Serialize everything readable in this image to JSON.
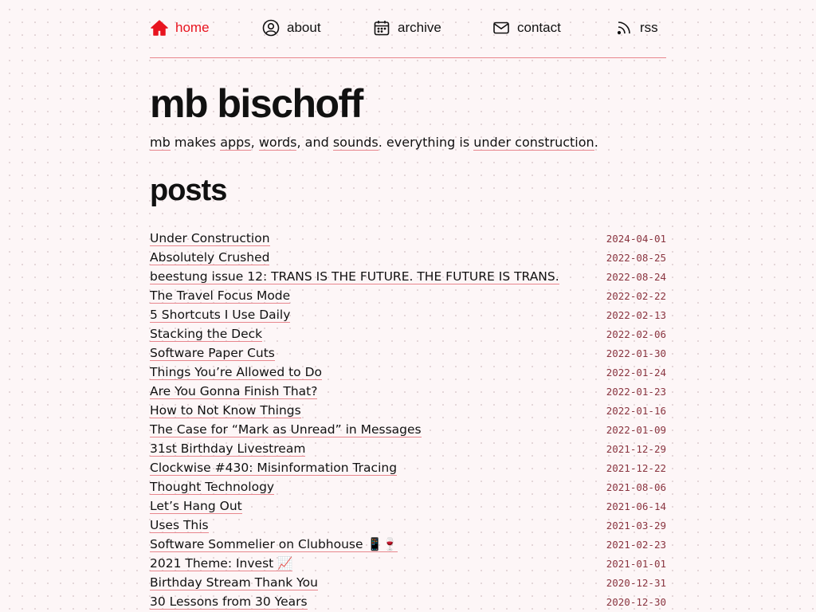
{
  "nav": {
    "items": [
      {
        "label": "home",
        "icon": "home-icon",
        "active": true
      },
      {
        "label": "about",
        "icon": "user-circle-icon",
        "active": false
      },
      {
        "label": "archive",
        "icon": "calendar-icon",
        "active": false
      },
      {
        "label": "contact",
        "icon": "mail-icon",
        "active": false
      },
      {
        "label": "rss",
        "icon": "rss-icon",
        "active": false
      }
    ]
  },
  "site": {
    "title": "mb bischoff",
    "tagline": {
      "mb": "mb",
      "makes": " makes ",
      "apps": "apps",
      "comma1": ", ",
      "words": "words",
      "and": ", and ",
      "sounds": "sounds",
      "everything": ". everything is ",
      "construction": "under construction",
      "period": "."
    }
  },
  "posts": {
    "heading": "posts",
    "items": [
      {
        "title": "Under Construction",
        "date": "2024-04-01"
      },
      {
        "title": "Absolutely Crushed",
        "date": "2022-08-25"
      },
      {
        "title": "beestung issue 12: TRANS IS THE FUTURE. THE FUTURE IS TRANS.",
        "date": "2022-08-24"
      },
      {
        "title": "The Travel Focus Mode",
        "date": "2022-02-22"
      },
      {
        "title": "5 Shortcuts I Use Daily",
        "date": "2022-02-13"
      },
      {
        "title": "Stacking the Deck",
        "date": "2022-02-06"
      },
      {
        "title": "Software Paper Cuts",
        "date": "2022-01-30"
      },
      {
        "title": "Things You’re Allowed to Do",
        "date": "2022-01-24"
      },
      {
        "title": "Are You Gonna Finish That?",
        "date": "2022-01-23"
      },
      {
        "title": "How to Not Know Things",
        "date": "2022-01-16"
      },
      {
        "title": "The Case for “Mark as Unread” in Messages",
        "date": "2022-01-09"
      },
      {
        "title": "31st Birthday Livestream",
        "date": "2021-12-29"
      },
      {
        "title": "Clockwise #430: Misinformation Tracing",
        "date": "2021-12-22"
      },
      {
        "title": "Thought Technology",
        "date": "2021-08-06"
      },
      {
        "title": "Let’s Hang Out",
        "date": "2021-06-14"
      },
      {
        "title": "Uses This",
        "date": "2021-03-29"
      },
      {
        "title": "Software Sommelier on Clubhouse 📱🍷",
        "date": "2021-02-23"
      },
      {
        "title": "2021 Theme: Invest 📈",
        "date": "2021-01-01"
      },
      {
        "title": "Birthday Stream Thank You",
        "date": "2020-12-31"
      },
      {
        "title": "30 Lessons from 30 Years",
        "date": "2020-12-30"
      }
    ]
  },
  "colors": {
    "accent": "#e8141f",
    "underline": "#e8868d",
    "date": "#8a3540",
    "background": "#fdf6f7"
  }
}
